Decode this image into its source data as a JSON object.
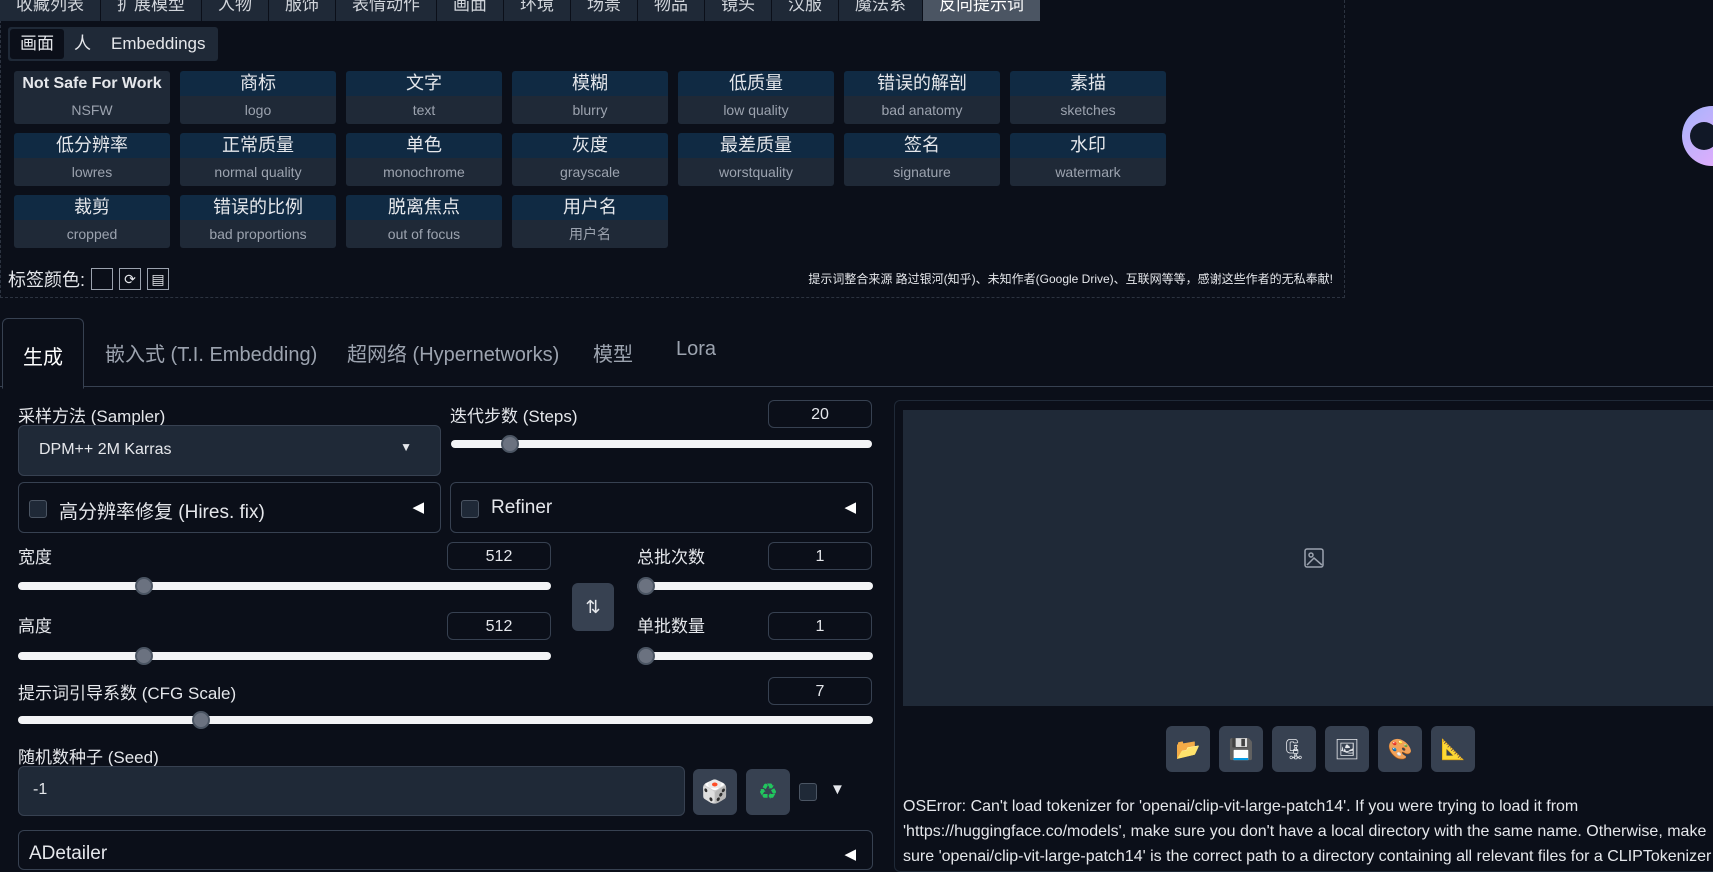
{
  "category_tabs": [
    "收藏列表",
    "扩展模型",
    "人物",
    "服饰",
    "表情动作",
    "画面",
    "环境",
    "场景",
    "物品",
    "镜头",
    "汉服",
    "魔法系",
    "反向提示词"
  ],
  "sub_tabs": [
    "画面",
    "人",
    "Embeddings"
  ],
  "tags": [
    {
      "zh": "Not Safe For Work",
      "en": "NSFW"
    },
    {
      "zh": "商标",
      "en": "logo"
    },
    {
      "zh": "文字",
      "en": "text"
    },
    {
      "zh": "模糊",
      "en": "blurry"
    },
    {
      "zh": "低质量",
      "en": "low quality"
    },
    {
      "zh": "错误的解剖",
      "en": "bad anatomy"
    },
    {
      "zh": "素描",
      "en": "sketches"
    },
    {
      "zh": "低分辨率",
      "en": "lowres"
    },
    {
      "zh": "正常质量",
      "en": "normal quality"
    },
    {
      "zh": "单色",
      "en": "monochrome"
    },
    {
      "zh": "灰度",
      "en": "grayscale"
    },
    {
      "zh": "最差质量",
      "en": "worstquality"
    },
    {
      "zh": "签名",
      "en": "signature"
    },
    {
      "zh": "水印",
      "en": "watermark"
    },
    {
      "zh": "裁剪",
      "en": "cropped"
    },
    {
      "zh": "错误的比例",
      "en": "bad proportions"
    },
    {
      "zh": "脱离焦点",
      "en": "out of focus"
    },
    {
      "zh": "用户名",
      "en": "用户名"
    }
  ],
  "tag_color_label": "标签颜色:",
  "credit": "提示词整合来源 路过银河(知乎)、未知作者(Google Drive)、互联网等等，感谢这些作者的无私奉献!",
  "gen_tabs": [
    "生成",
    "嵌入式 (T.I. Embedding)",
    "超网络 (Hypernetworks)",
    "模型",
    "Lora"
  ],
  "sampler": {
    "label": "采样方法 (Sampler)",
    "value": "DPM++ 2M Karras"
  },
  "steps": {
    "label": "迭代步数 (Steps)",
    "value": "20"
  },
  "hires": {
    "label": "高分辨率修复 (Hires. fix)"
  },
  "refiner": {
    "label": "Refiner"
  },
  "width": {
    "label": "宽度",
    "value": "512"
  },
  "height": {
    "label": "高度",
    "value": "512"
  },
  "batch_count": {
    "label": "总批次数",
    "value": "1"
  },
  "batch_size": {
    "label": "单批数量",
    "value": "1"
  },
  "cfg": {
    "label": "提示词引导系数 (CFG Scale)",
    "value": "7"
  },
  "seed": {
    "label": "随机数种子 (Seed)",
    "value": "-1"
  },
  "adetailer": {
    "label": "ADetailer"
  },
  "error_lines": [
    "OSError: Can't load tokenizer for 'openai/clip-vit-large-patch14'. If you were trying to load it from",
    "'https://huggingface.co/models', make sure you don't have a local directory with the same name. Otherwise, make",
    "sure 'openai/clip-vit-large-patch14' is the correct path to a directory containing all relevant files for a CLIPTokenizer"
  ],
  "colors": {
    "background": "#0b0f19",
    "panel": "#1f2937",
    "tag_top": "#102a43",
    "active_tab": "#4b5563"
  },
  "icons": [
    "folder-icon",
    "save-icon",
    "zip-icon",
    "image-icon",
    "palette-icon",
    "ruler-icon",
    "dice-icon",
    "recycle-icon",
    "swap-icon",
    "image-placeholder-icon"
  ]
}
